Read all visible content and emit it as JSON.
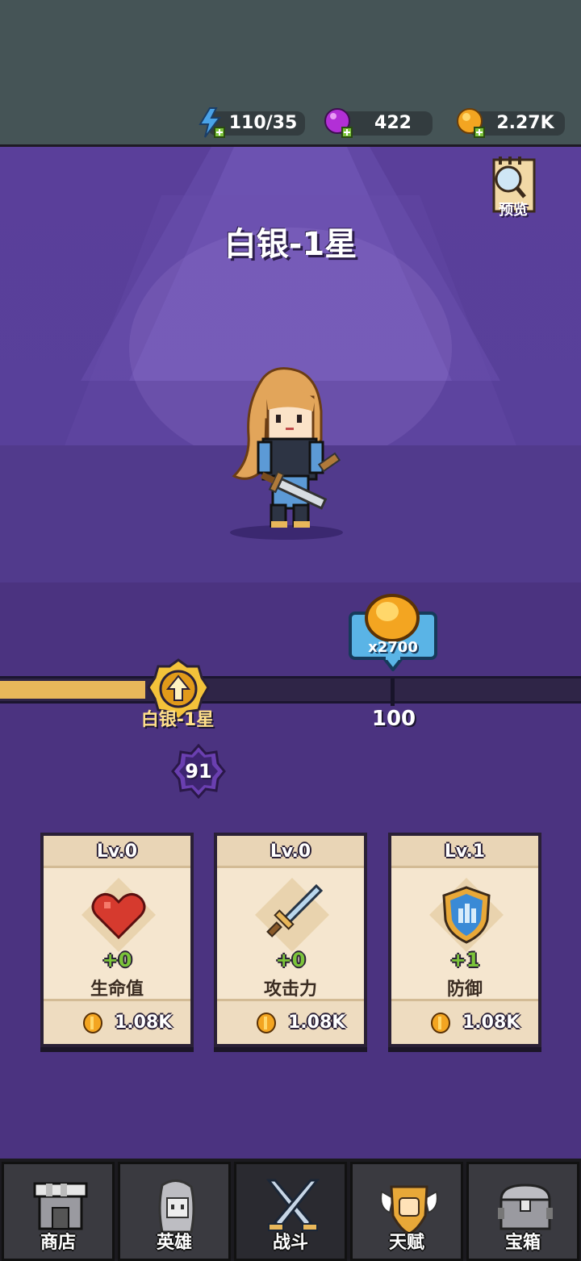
{
  "resources": {
    "energy": {
      "icon": "lightning-plus-icon",
      "value": "110/35"
    },
    "gems": {
      "icon": "purple-gem-plus-icon",
      "value": "422"
    },
    "coins": {
      "icon": "gold-coin-plus-icon",
      "value": "2.27K"
    }
  },
  "stage": {
    "rank_title": "白银-1星",
    "preview_label": "预览"
  },
  "progress": {
    "current_rank_label": "白银-1星",
    "fill_fraction": 0.25,
    "next_tick_value": "100",
    "reward_label": "x2700",
    "level": "91"
  },
  "cards": [
    {
      "level": "Lv.0",
      "icon": "heart-icon",
      "bonus": "+0",
      "name": "生命值",
      "cost": "1.08K"
    },
    {
      "level": "Lv.0",
      "icon": "sword-icon",
      "bonus": "+0",
      "name": "攻击力",
      "cost": "1.08K"
    },
    {
      "level": "Lv.1",
      "icon": "shield-icon",
      "bonus": "+1",
      "name": "防御",
      "cost": "1.08K"
    }
  ],
  "nav": [
    {
      "label": "商店",
      "icon": "shop-icon",
      "active": false
    },
    {
      "label": "英雄",
      "icon": "hero-icon",
      "active": false
    },
    {
      "label": "战斗",
      "icon": "crossed-swords-icon",
      "active": true
    },
    {
      "label": "天赋",
      "icon": "talent-fist-icon",
      "active": false
    },
    {
      "label": "宝箱",
      "icon": "treasure-chest-icon",
      "active": false
    }
  ],
  "colors": {
    "stage_purple": "#4b3380",
    "track_fill": "#e8b75a",
    "card_bg": "#f5e6cf",
    "bonus_green": "#7cc43a"
  }
}
